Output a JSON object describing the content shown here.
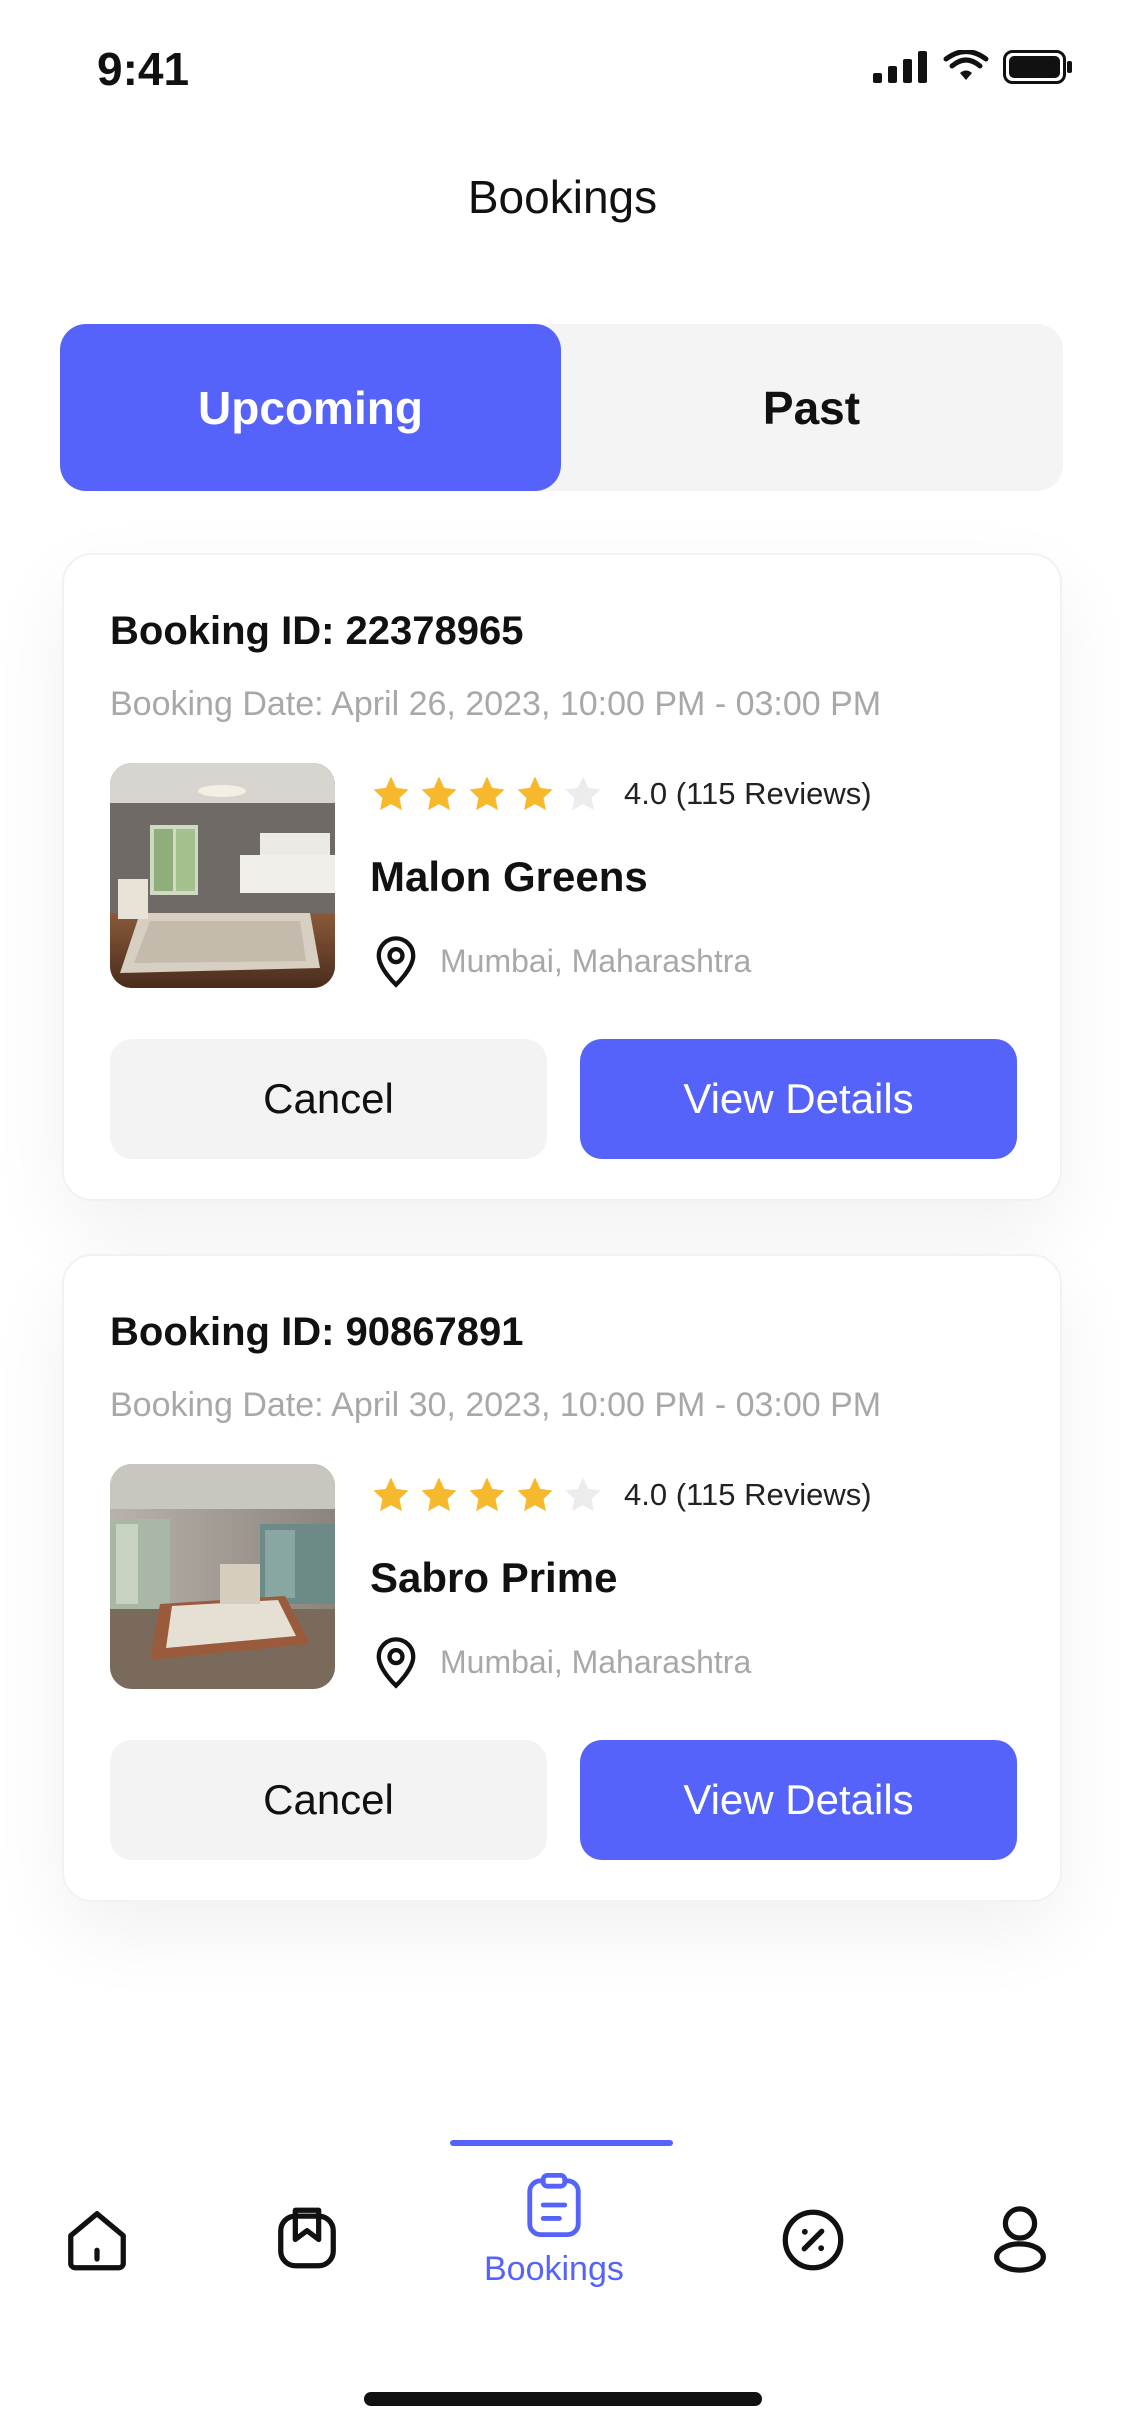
{
  "status": {
    "time": "9:41"
  },
  "header": {
    "title": "Bookings"
  },
  "tabs": [
    {
      "label": "Upcoming",
      "active": true
    },
    {
      "label": "Past",
      "active": false
    }
  ],
  "bookings": [
    {
      "booking_id": "Booking ID: 22378965",
      "booking_date": "Booking Date: April 26, 2023, 10:00 PM - 03:00 PM",
      "rating_text": "4.0 (115 Reviews)",
      "stars_filled": 4,
      "hotel_name": "Malon Greens",
      "location": "Mumbai, Maharashtra",
      "cancel_label": "Cancel",
      "details_label": "View Details"
    },
    {
      "booking_id": "Booking ID: 90867891",
      "booking_date": "Booking Date: April 30, 2023, 10:00 PM - 03:00 PM",
      "rating_text": "4.0 (115 Reviews)",
      "stars_filled": 4,
      "hotel_name": "Sabro Prime",
      "location": "Mumbai, Maharashtra",
      "cancel_label": "Cancel",
      "details_label": "View Details"
    }
  ],
  "nav": {
    "items": [
      {
        "icon": "home-icon"
      },
      {
        "icon": "bookmark-icon"
      },
      {
        "icon": "clipboard-icon",
        "label": "Bookings",
        "active": true
      },
      {
        "icon": "discount-icon"
      },
      {
        "icon": "profile-icon"
      }
    ]
  },
  "colors": {
    "accent": "#5563fb",
    "star": "#f6b82c",
    "star_empty": "#e8e8e8"
  }
}
